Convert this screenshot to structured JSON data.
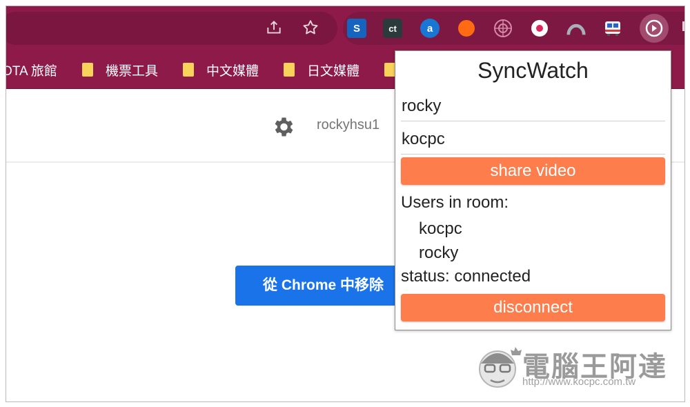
{
  "bookmarks": [
    {
      "label": "OTA 旅館"
    },
    {
      "label": "機票工具"
    },
    {
      "label": "中文媒體"
    },
    {
      "label": "日文媒體"
    }
  ],
  "extensions": [
    {
      "name": "s-extension-icon",
      "glyph": "S",
      "color": "#1565c0"
    },
    {
      "name": "ct-extension-icon",
      "glyph": "ct",
      "color": "#2b3a3a"
    },
    {
      "name": "a-extension-icon",
      "glyph": "a",
      "color": "#1976d2"
    },
    {
      "name": "flame-extension-icon",
      "glyph": "",
      "color": "#ff6a13"
    },
    {
      "name": "web-extension-icon",
      "glyph": "",
      "color": "#c96a8a"
    },
    {
      "name": "record-extension-icon",
      "glyph": "",
      "color": "#ffffff"
    },
    {
      "name": "arch-extension-icon",
      "glyph": "",
      "color": "#9fa9b2"
    },
    {
      "name": "train-extension-icon",
      "glyph": "",
      "color": "#e8eef5"
    },
    {
      "name": "syncwatch-extension-icon",
      "glyph": "",
      "color": "#ffffff"
    }
  ],
  "page": {
    "username": "rockyhsu1",
    "remove_button": "從 Chrome 中移除"
  },
  "popup": {
    "title": "SyncWatch",
    "name_value": "rocky",
    "room_value": "kocpc",
    "share_label": "share video",
    "users_heading": "Users in room:",
    "users": [
      "kocpc",
      "rocky"
    ],
    "status": "status: connected",
    "disconnect_label": "disconnect"
  },
  "watermark": {
    "title": "電腦王阿達",
    "url": "http://www.kocpc.com.tw"
  },
  "colors": {
    "toolbar": "#8e1a4a",
    "accent_button": "#fd7d4d",
    "chrome_blue": "#1a73e8"
  }
}
